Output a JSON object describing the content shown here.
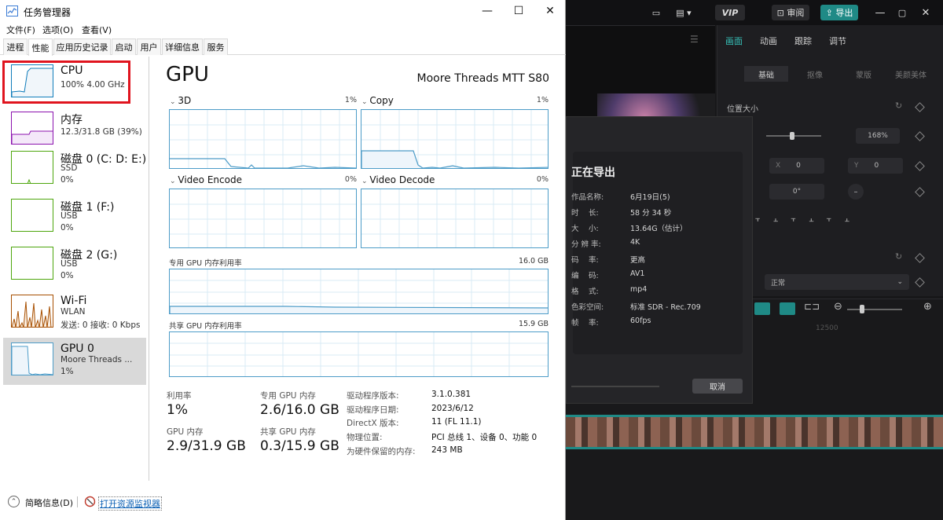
{
  "editor": {
    "top_buttons": {
      "vip": "VIP",
      "review": "审阅",
      "export": "导出"
    },
    "panel_tabs": [
      "画面",
      "动画",
      "跟踪",
      "调节"
    ],
    "panel_subtabs": [
      "基础",
      "抠像",
      "蒙版",
      "美颜美体"
    ],
    "position_size_label": "位置大小",
    "scale_value": "168%",
    "x_label": "X",
    "x_value": "0",
    "y_label": "Y",
    "y_value": "0",
    "rotation_value": "0°",
    "blend_value": "正常",
    "timeline_ruler": "12500",
    "accent_color": "#1f8a86"
  },
  "export_dialog": {
    "title": "正在导出",
    "rows": [
      {
        "k": "作品名称:",
        "v": "6月19日(5)"
      },
      {
        "k": "时　 长:",
        "v": "58 分 34 秒"
      },
      {
        "k": "大　 小:",
        "v": "13.64G（估计）"
      },
      {
        "k": "分 辨 率:",
        "v": "4K"
      },
      {
        "k": "码　 率:",
        "v": "更高"
      },
      {
        "k": "编　 码:",
        "v": "AV1"
      },
      {
        "k": "格　 式:",
        "v": "mp4"
      },
      {
        "k": "色彩空间:",
        "v": "标准 SDR - Rec.709"
      },
      {
        "k": "帧　 率:",
        "v": "60fps"
      }
    ],
    "cancel": "取消"
  },
  "taskmgr": {
    "title": "任务管理器",
    "menu": [
      "文件(F)",
      "选项(O)",
      "查看(V)"
    ],
    "tabs": [
      "进程",
      "性能",
      "应用历史记录",
      "启动",
      "用户",
      "详细信息",
      "服务"
    ],
    "sidebar": [
      {
        "name": "CPU",
        "sub1": "100% 4.00 GHz",
        "sub2": ""
      },
      {
        "name": "内存",
        "sub1": "12.3/31.8 GB (39%)",
        "sub2": ""
      },
      {
        "name": "磁盘 0 (C: D: E:)",
        "sub1": "SSD",
        "sub2": "0%"
      },
      {
        "name": "磁盘 1 (F:)",
        "sub1": "USB",
        "sub2": "0%"
      },
      {
        "name": "磁盘 2 (G:)",
        "sub1": "USB",
        "sub2": "0%"
      },
      {
        "name": "Wi-Fi",
        "sub1": "WLAN",
        "sub2": "发送: 0 接收: 0 Kbps"
      },
      {
        "name": "GPU 0",
        "sub1": "Moore Threads ...",
        "sub2": "1%"
      }
    ],
    "gpu": {
      "title": "GPU",
      "model": "Moore Threads MTT S80",
      "graphs": [
        {
          "name": "3D",
          "pct": "1%"
        },
        {
          "name": "Copy",
          "pct": "1%"
        },
        {
          "name": "Video Encode",
          "pct": "0%"
        },
        {
          "name": "Video Decode",
          "pct": "0%"
        }
      ],
      "dedicated_label": "专用 GPU 内存利用率",
      "dedicated_max": "16.0 GB",
      "shared_label": "共享 GPU 内存利用率",
      "shared_max": "15.9 GB",
      "stats": {
        "util_label": "利用率",
        "util_value": "1%",
        "ded_label": "专用 GPU 内存",
        "ded_value": "2.6/16.0 GB",
        "gpumem_label": "GPU 内存",
        "gpumem_value": "2.9/31.9 GB",
        "shared_label": "共享 GPU 内存",
        "shared_value": "0.3/15.9 GB"
      },
      "info": [
        {
          "k": "驱动程序版本:",
          "v": "3.1.0.381"
        },
        {
          "k": "驱动程序日期:",
          "v": "2023/6/12"
        },
        {
          "k": "DirectX 版本:",
          "v": "11 (FL 11.1)"
        },
        {
          "k": "物理位置:",
          "v": "PCI 总线 1、设备 0、功能 0"
        },
        {
          "k": "为硬件保留的内存:",
          "v": "243 MB"
        }
      ]
    },
    "footer": {
      "less_details": "简略信息(D)",
      "open_monitor": "打开资源监视器"
    },
    "colors": {
      "gpu_line": "#4d9cc8",
      "cpu_line": "#117dbb",
      "mem_line": "#8b12ae",
      "disk_line": "#4da60c",
      "net_line": "#a74f01",
      "highlight": "#e0141e"
    }
  }
}
